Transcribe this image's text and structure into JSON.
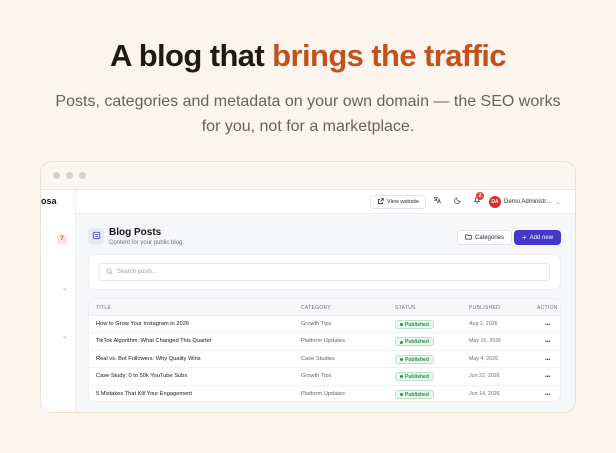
{
  "hero": {
    "title_main": "A blog that ",
    "title_accent": "brings the traffic",
    "subtitle_line1": "Posts, categories and metadata on your own domain — the SEO works",
    "subtitle_line2": "for you, not for a marketplace."
  },
  "colors": {
    "accent": "#c4511c",
    "primary": "#4338ca",
    "published": "#2e8a4e",
    "badge": "#e0433a"
  },
  "sidebar": {
    "brand": "osa",
    "badge": "7"
  },
  "topbar": {
    "view_website": "View website",
    "notification_count": "2",
    "user_initials": "DA",
    "user_name": "Demo Administr…"
  },
  "page": {
    "title": "Blog Posts",
    "subtitle": "Content for your public blog.",
    "categories_button": "Categories",
    "add_new_button": "Add new"
  },
  "search": {
    "placeholder": "Search posts..."
  },
  "table": {
    "columns": {
      "title": "TITLE",
      "category": "CATEGORY",
      "status": "STATUS",
      "published": "PUBLISHED",
      "action": "ACTION"
    },
    "rows": [
      {
        "title": "How to Grow Your Instagram in 2026",
        "category": "Growth Tips",
        "status": "Published",
        "published": "Aug 1, 2026"
      },
      {
        "title": "TikTok Algorithm: What Changed This Quarter",
        "category": "Platform Updates",
        "status": "Published",
        "published": "May 15, 2026"
      },
      {
        "title": "Real vs. Bot Followers: Why Quality Wins",
        "category": "Case Studies",
        "status": "Published",
        "published": "May 4, 2026"
      },
      {
        "title": "Case Study: 0 to 50k YouTube Subs",
        "category": "Growth Tips",
        "status": "Published",
        "published": "Jun 22, 2026"
      },
      {
        "title": "5 Mistakes That Kill Your Engagement",
        "category": "Platform Updates",
        "status": "Published",
        "published": "Jun 14, 2026"
      }
    ]
  }
}
